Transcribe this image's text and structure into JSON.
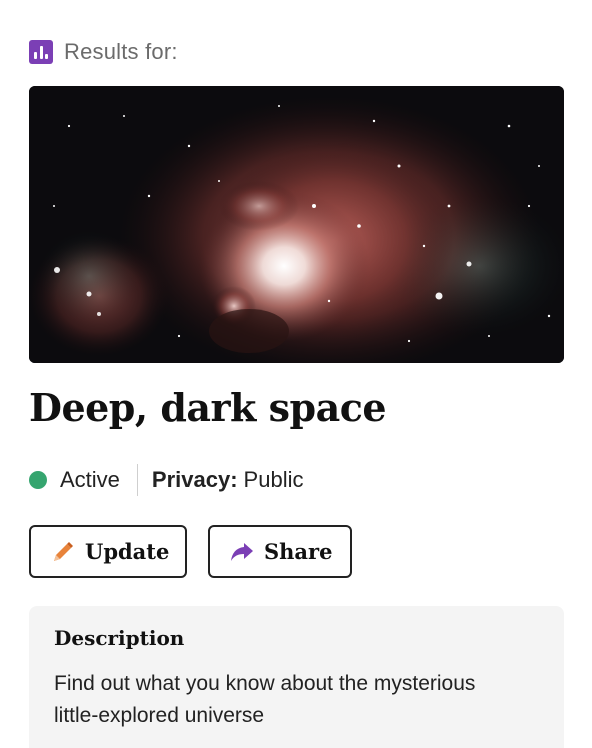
{
  "header": {
    "results_label": "Results for:",
    "icon": "bar-chart-icon",
    "icon_color": "#7b3fb5"
  },
  "hero_image": {
    "subject": "nebula-image"
  },
  "item": {
    "title": "Deep, dark space",
    "status": "Active",
    "status_color": "#35a56f",
    "privacy_key": "Privacy:",
    "privacy_value": "Public"
  },
  "actions": {
    "update_label": "Update",
    "update_icon": "pencil-icon",
    "share_label": "Share",
    "share_icon": "share-arrow-icon",
    "share_icon_color": "#7b3fb5",
    "update_icon_color": "#e8833a"
  },
  "description": {
    "heading": "Description",
    "text": "Find out what you know about the mysterious little-explored universe"
  }
}
